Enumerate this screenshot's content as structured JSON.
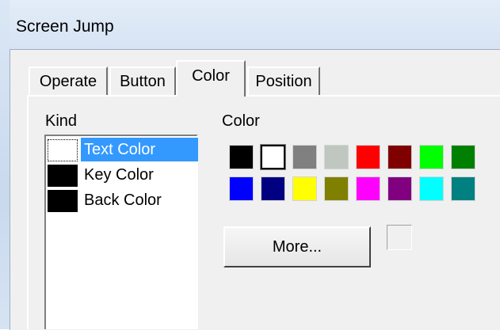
{
  "window": {
    "title": "Screen Jump"
  },
  "tabs": [
    {
      "label": "Operate",
      "active": false
    },
    {
      "label": "Button",
      "active": false
    },
    {
      "label": "Color",
      "active": true
    },
    {
      "label": "Position",
      "active": false
    }
  ],
  "kind": {
    "label": "Kind",
    "items": [
      {
        "label": "Text Color",
        "swatch": "#ffffff",
        "selected": true
      },
      {
        "label": "Key Color",
        "swatch": "#000000",
        "selected": false
      },
      {
        "label": "Back Color",
        "swatch": "#000000",
        "selected": false
      }
    ]
  },
  "color": {
    "label": "Color",
    "palette": [
      "#000000",
      "#ffffff",
      "#808080",
      "#c0c7c0",
      "#ff0000",
      "#800000",
      "#00ff00",
      "#008000",
      "#0000ff",
      "#000080",
      "#ffff00",
      "#808000",
      "#ff00ff",
      "#800080",
      "#00ffff",
      "#008080"
    ],
    "selected_index": 1,
    "more_label": "More..."
  }
}
